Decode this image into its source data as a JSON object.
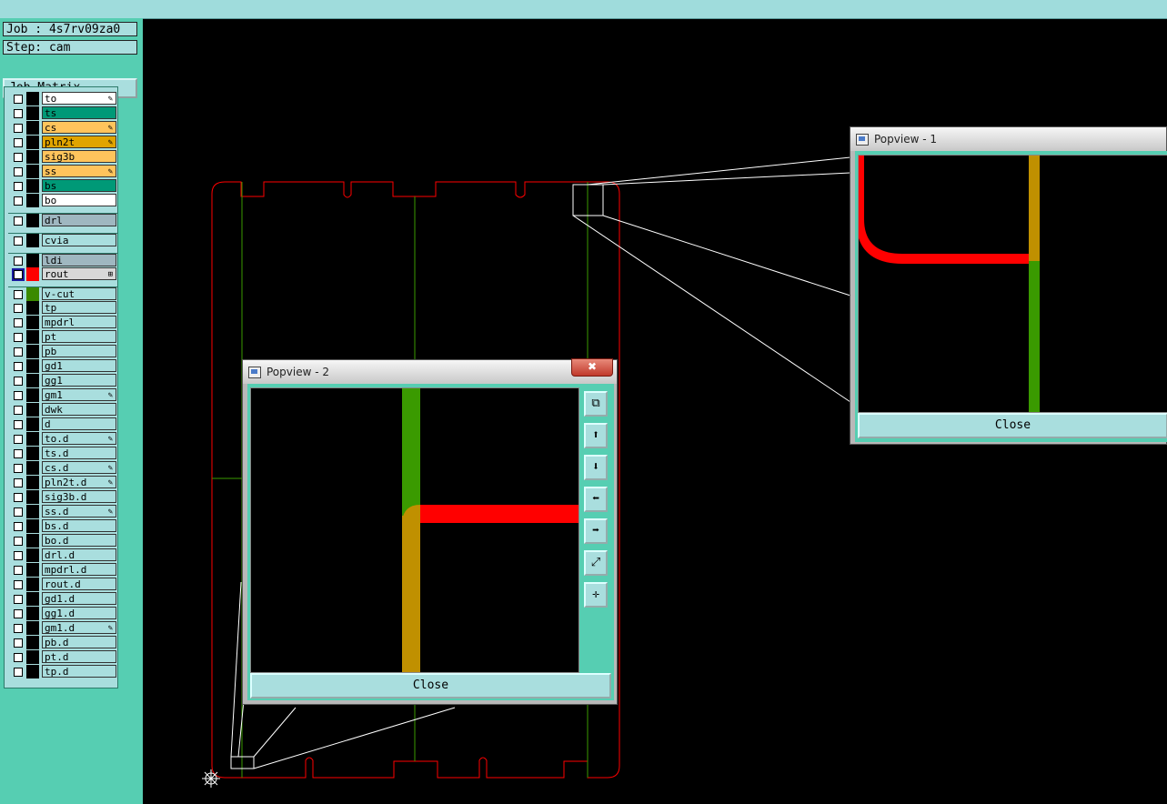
{
  "job": {
    "label": "Job : 4s7rv09za0",
    "step": "Step: cam",
    "matrix_button": "Job Matrix ..."
  },
  "layers": [
    {
      "name": "to",
      "color": "#ffffff",
      "swatch": "#000000",
      "mark": "✎"
    },
    {
      "name": "ts",
      "color": "#009977",
      "swatch": "#000000",
      "mark": ""
    },
    {
      "name": "cs",
      "color": "#ffc45c",
      "swatch": "#000000",
      "mark": "✎"
    },
    {
      "name": "pln2t",
      "color": "#e0a400",
      "swatch": "#000000",
      "mark": "✎"
    },
    {
      "name": "sig3b",
      "color": "#ffc45c",
      "swatch": "#000000",
      "mark": ""
    },
    {
      "name": "ss",
      "color": "#ffc45c",
      "swatch": "#000000",
      "mark": "✎"
    },
    {
      "name": "bs",
      "color": "#009977",
      "swatch": "#000000",
      "mark": ""
    },
    {
      "name": "bo",
      "color": "#ffffff",
      "swatch": "#000000",
      "mark": ""
    },
    {
      "name": "drl",
      "color": "#9fb7c0",
      "swatch": "#000000",
      "mark": "",
      "sep": true
    },
    {
      "name": "cvia",
      "color": "#a9dede",
      "swatch": "#000000",
      "mark": "",
      "sep": true
    },
    {
      "name": "ldi",
      "color": "#9fb7c0",
      "swatch": "#000000",
      "mark": "",
      "sep": true
    },
    {
      "name": "rout",
      "color": "#d8d8d8",
      "swatch": "#ff0000",
      "mark": "⊞",
      "active": true
    },
    {
      "name": "v-cut",
      "color": "#a9dede",
      "swatch": "#3a8a00",
      "mark": "",
      "sep": true
    },
    {
      "name": "tp",
      "color": "#a9dede",
      "swatch": "#000000",
      "mark": ""
    },
    {
      "name": "mpdrl",
      "color": "#a9dede",
      "swatch": "#000000",
      "mark": ""
    },
    {
      "name": "pt",
      "color": "#a9dede",
      "swatch": "#000000",
      "mark": ""
    },
    {
      "name": "pb",
      "color": "#a9dede",
      "swatch": "#000000",
      "mark": ""
    },
    {
      "name": "gd1",
      "color": "#a9dede",
      "swatch": "#000000",
      "mark": ""
    },
    {
      "name": "gg1",
      "color": "#a9dede",
      "swatch": "#000000",
      "mark": ""
    },
    {
      "name": "gm1",
      "color": "#a9dede",
      "swatch": "#000000",
      "mark": "✎"
    },
    {
      "name": "dwk",
      "color": "#a9dede",
      "swatch": "#000000",
      "mark": ""
    },
    {
      "name": "d",
      "color": "#a9dede",
      "swatch": "#000000",
      "mark": ""
    },
    {
      "name": "to.d",
      "color": "#a9dede",
      "swatch": "#000000",
      "mark": "✎"
    },
    {
      "name": "ts.d",
      "color": "#a9dede",
      "swatch": "#000000",
      "mark": ""
    },
    {
      "name": "cs.d",
      "color": "#a9dede",
      "swatch": "#000000",
      "mark": "✎"
    },
    {
      "name": "pln2t.d",
      "color": "#a9dede",
      "swatch": "#000000",
      "mark": "✎"
    },
    {
      "name": "sig3b.d",
      "color": "#a9dede",
      "swatch": "#000000",
      "mark": ""
    },
    {
      "name": "ss.d",
      "color": "#a9dede",
      "swatch": "#000000",
      "mark": "✎"
    },
    {
      "name": "bs.d",
      "color": "#a9dede",
      "swatch": "#000000",
      "mark": ""
    },
    {
      "name": "bo.d",
      "color": "#a9dede",
      "swatch": "#000000",
      "mark": ""
    },
    {
      "name": "drl.d",
      "color": "#a9dede",
      "swatch": "#000000",
      "mark": ""
    },
    {
      "name": "mpdrl.d",
      "color": "#a9dede",
      "swatch": "#000000",
      "mark": ""
    },
    {
      "name": "rout.d",
      "color": "#a9dede",
      "swatch": "#000000",
      "mark": ""
    },
    {
      "name": "gd1.d",
      "color": "#a9dede",
      "swatch": "#000000",
      "mark": ""
    },
    {
      "name": "gg1.d",
      "color": "#a9dede",
      "swatch": "#000000",
      "mark": ""
    },
    {
      "name": "gm1.d",
      "color": "#a9dede",
      "swatch": "#000000",
      "mark": "✎"
    },
    {
      "name": "pb.d",
      "color": "#a9dede",
      "swatch": "#000000",
      "mark": ""
    },
    {
      "name": "pt.d",
      "color": "#a9dede",
      "swatch": "#000000",
      "mark": ""
    },
    {
      "name": "tp.d",
      "color": "#a9dede",
      "swatch": "#000000",
      "mark": ""
    }
  ],
  "popview1": {
    "title": "Popview - 1",
    "close": "Close"
  },
  "popview2": {
    "title": "Popview - 2",
    "close": "Close",
    "close_x": "✖",
    "tools": [
      "zoom-fit-icon",
      "zoom-in-icon",
      "zoom-out-icon",
      "pan-left-icon",
      "pan-right-icon",
      "zoom-extents-icon",
      "pan-center-icon"
    ]
  },
  "colors": {
    "route": "#ff0000",
    "vcut": "#3a9a00",
    "overlap": "#c09000",
    "panel": "#56ceb2",
    "button": "#a9dede"
  }
}
